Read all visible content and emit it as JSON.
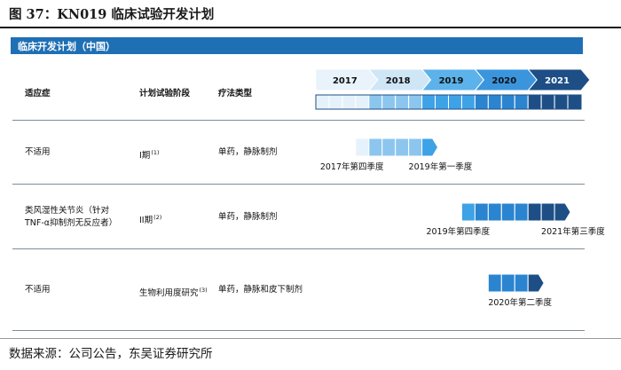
{
  "figure_title": "图 37：KN019 临床试验开发计划",
  "banner_title": "临床开发计划（中国）",
  "headers": {
    "indication": "适应症",
    "phase": "计划试验阶段",
    "therapy": "疗法类型"
  },
  "colors": {
    "banner": "#1f6fb5",
    "dark": "#1d4f86",
    "light": "#e6f2fb",
    "mid": "#2f8fd6"
  },
  "chart_data": {
    "type": "gantt",
    "years": [
      "2017",
      "2018",
      "2019",
      "2020",
      "2021"
    ],
    "quarters_per_year": 4,
    "rows": [
      {
        "indication": "不适用",
        "phase": "I期",
        "phase_note": "(1)",
        "therapy": "单药，静脉制剂",
        "start": "2017Q4",
        "end": "2019Q1",
        "start_label": "2017年第四季度",
        "end_label": "2019年第一季度"
      },
      {
        "indication": "类风湿性关节炎（针对TNF-α抑制剂无反应者）",
        "indication_line1": "类风湿性关节炎（针对",
        "indication_line2": "TNF-α抑制剂无反应者）",
        "phase": "II期",
        "phase_note": "(2)",
        "therapy": "单药，静脉制剂",
        "start": "2019Q4",
        "end": "2021Q3",
        "start_label": "2019年第四季度",
        "end_label": "2021年第三季度"
      },
      {
        "indication": "不适用",
        "phase": "生物利用度研究",
        "phase_note": "(3)",
        "therapy": "单药，静脉和皮下制剂",
        "start": "2020Q2",
        "end": "2021Q1",
        "start_label": "",
        "end_label": "2020年第二季度"
      }
    ]
  },
  "source": "数据来源：公司公告，东吴证券研究所"
}
